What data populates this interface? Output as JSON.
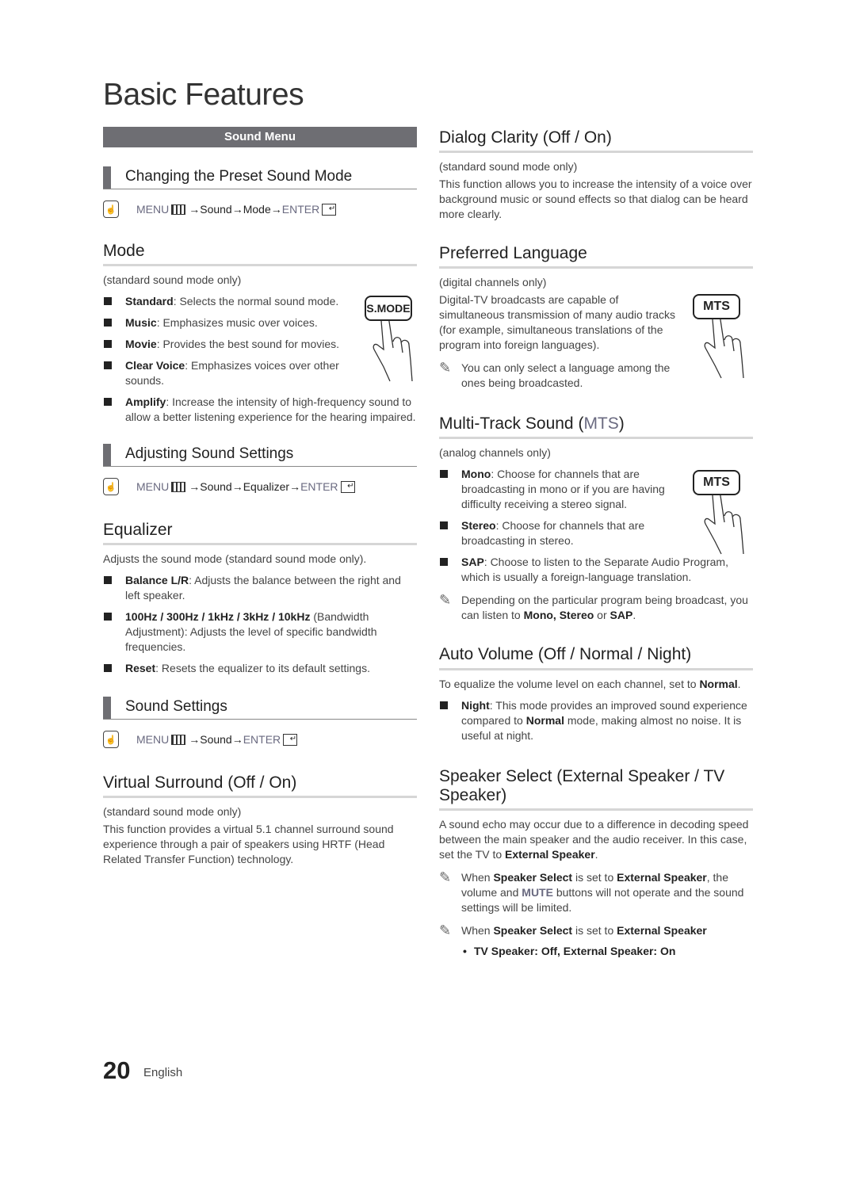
{
  "page": {
    "title": "Basic Features",
    "page_number": "20",
    "language": "English"
  },
  "left": {
    "band": "Sound Menu",
    "preset": {
      "heading": "Changing the Preset Sound Mode",
      "path": {
        "menu": "MENU",
        "arrow1": " → ",
        "sound": "Sound",
        "arrow2": " → ",
        "item": "Mode",
        "arrow3": " →",
        "enter": "ENTER"
      }
    },
    "mode": {
      "heading": "Mode",
      "note": "(standard sound mode only)",
      "button_label": "S.MODE",
      "items": [
        {
          "key": "Standard",
          "text": ": Selects the normal sound mode."
        },
        {
          "key": "Music",
          "text": ": Emphasizes music over voices."
        },
        {
          "key": "Movie",
          "text": ": Provides the best sound for movies."
        },
        {
          "key": "Clear Voice",
          "text": ": Emphasizes voices over other sounds."
        },
        {
          "key": "Amplify",
          "text": ": Increase the intensity of high-frequency sound to allow a better listening experience for the hearing impaired."
        }
      ]
    },
    "adjust": {
      "heading": "Adjusting Sound Settings",
      "path": {
        "menu": "MENU",
        "arrow1": " → ",
        "sound": "Sound",
        "arrow2": " → ",
        "item": "Equalizer",
        "arrow3": " →",
        "enter": "ENTER"
      }
    },
    "equalizer": {
      "heading": "Equalizer",
      "intro": "Adjusts the sound mode (standard sound mode only).",
      "items": [
        {
          "key": "Balance L/R",
          "text": ": Adjusts the balance between the right and left speaker."
        },
        {
          "key": "100Hz / 300Hz / 1kHz / 3kHz / 10kHz",
          "text": " (Bandwidth Adjustment): Adjusts the level of specific bandwidth frequencies."
        },
        {
          "key": "Reset",
          "text": ": Resets the equalizer to its default settings."
        }
      ]
    },
    "settings": {
      "heading": "Sound Settings",
      "path": {
        "menu": "MENU",
        "arrow1": " → ",
        "sound": "Sound",
        "arrow2": " → ",
        "enter": "ENTER"
      }
    },
    "virtual": {
      "heading": "Virtual Surround (Off / On)",
      "note": "(standard sound mode only)",
      "text": "This function provides a virtual 5.1 channel surround sound experience through a pair of speakers using HRTF (Head Related Transfer Function) technology."
    }
  },
  "right": {
    "dialog": {
      "heading": "Dialog Clarity (Off / On)",
      "note": "(standard sound mode only)",
      "text": "This function allows you to increase the intensity of a voice over background music or sound effects so that dialog can be heard more clearly."
    },
    "language": {
      "heading": "Preferred Language",
      "note": "(digital channels only)",
      "text": "Digital-TV broadcasts are capable of simultaneous transmission of many audio tracks (for example, simultaneous translations of the program into foreign languages).",
      "tip": "You can only select a language among the ones being broadcasted.",
      "button_label": "MTS"
    },
    "mts": {
      "heading_main": "Multi-Track Sound (",
      "heading_key": "MTS",
      "heading_end": ")",
      "note": "(analog channels only)",
      "button_label": "MTS",
      "items": [
        {
          "key": "Mono",
          "text": ": Choose for channels that are broadcasting in mono or if you are having difficulty receiving a stereo signal."
        },
        {
          "key": "Stereo",
          "text": ": Choose for channels that are broadcasting in stereo."
        },
        {
          "key": "SAP",
          "text": ": Choose to listen to the Separate Audio Program, which is usually a foreign-language translation."
        }
      ],
      "tip_pre": "Depending on the particular program being broadcast, you can listen to ",
      "tip_key1": "Mono, Stereo",
      "tip_mid": " or ",
      "tip_key2": "SAP",
      "tip_end": "."
    },
    "auto": {
      "heading": "Auto Volume (Off / Normal / Night)",
      "intro_pre": "To equalize the volume level on each channel, set to ",
      "intro_key": "Normal",
      "intro_end": ".",
      "item_key": "Night",
      "item_pre": ": This mode provides an improved sound experience compared to ",
      "item_key2": "Normal",
      "item_end": " mode, making almost no noise. It is useful at night."
    },
    "speaker": {
      "heading": "Speaker Select (External Speaker / TV Speaker)",
      "text_pre": "A sound echo may occur due to a difference in decoding speed between the main speaker and the audio receiver. In this case, set the TV to ",
      "text_key": "External Speaker",
      "text_end": ".",
      "tip1": {
        "pre": "When ",
        "k1": "Speaker Select",
        "mid": " is set to ",
        "k2": "External Speaker",
        "mid2": ", the volume and ",
        "k3": "MUTE",
        "end": " buttons will not operate and the sound settings will be limited."
      },
      "tip2": {
        "pre": "When ",
        "k1": "Speaker Select",
        "mid": " is set to ",
        "k2": "External Speaker"
      },
      "bullet": "TV Speaker: Off, External Speaker: On"
    }
  }
}
